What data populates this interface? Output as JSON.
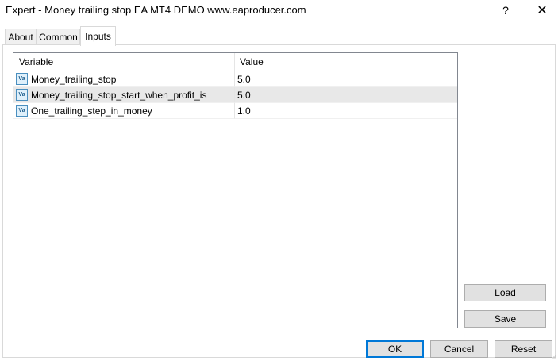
{
  "window": {
    "title": "Expert - Money trailing stop EA MT4 DEMO www.eaproducer.com",
    "help_label": "?",
    "close_label": "✕"
  },
  "tabs": [
    {
      "label": "About"
    },
    {
      "label": "Common"
    },
    {
      "label": "Inputs",
      "active": true
    }
  ],
  "grid": {
    "columns": [
      "Variable",
      "Value"
    ],
    "icon_text": "Va",
    "rows": [
      {
        "variable": "Money_trailing_stop",
        "value": "5.0"
      },
      {
        "variable": "Money_trailing_stop_start_when_profit_is",
        "value": "5.0",
        "selected": true
      },
      {
        "variable": "One_trailing_step_in_money",
        "value": "1.0"
      }
    ]
  },
  "side_buttons": {
    "load": "Load",
    "save": "Save"
  },
  "footer_buttons": {
    "ok": "OK",
    "cancel": "Cancel",
    "reset": "Reset"
  }
}
